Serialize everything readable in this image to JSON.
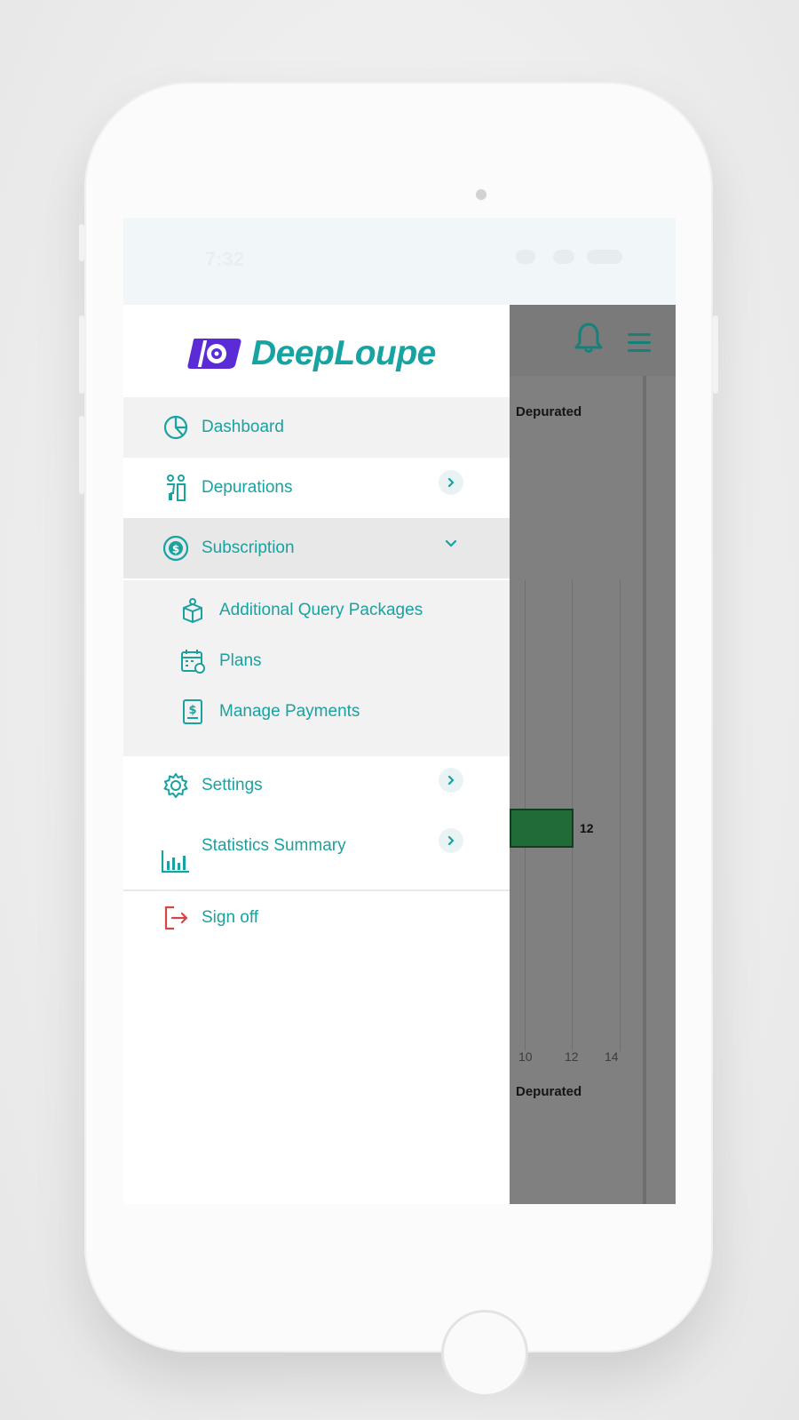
{
  "status_bar": {
    "time": "7:32"
  },
  "app": {
    "name": "DeepLoupe"
  },
  "menu": {
    "items": [
      {
        "label": "Dashboard",
        "icon": "pie-chart-icon"
      },
      {
        "label": "Depurations",
        "icon": "people-icon"
      },
      {
        "label": "Subscription",
        "icon": "dollar-cycle-icon"
      },
      {
        "label": "Settings",
        "icon": "gear-icon"
      },
      {
        "label": "Statistics Summary",
        "icon": "bar-chart-icon"
      }
    ],
    "subscription_items": [
      {
        "label": "Additional Query Packages",
        "icon": "package-icon"
      },
      {
        "label": "Plans",
        "icon": "calendar-icon"
      },
      {
        "label": "Manage Payments",
        "icon": "payment-doc-icon"
      }
    ],
    "sign_off": {
      "label": "Sign off",
      "icon": "sign-out-icon"
    }
  },
  "background_screen": {
    "label_top": "Depurated",
    "label_bottom": "Depurated",
    "ticks": [
      "10",
      "12",
      "14"
    ],
    "bar_value": "12"
  },
  "colors": {
    "accent": "#18a2a0",
    "logo_purple": "#5b2bd6",
    "sign_off_red": "#d64545",
    "bar_green": "#206b36"
  }
}
